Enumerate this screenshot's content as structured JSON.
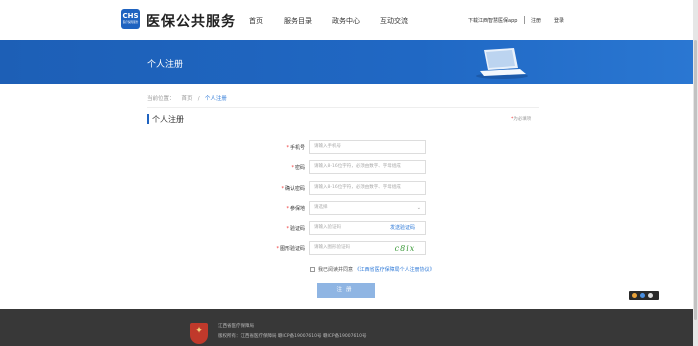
{
  "header": {
    "logo_text": "CHS",
    "logo_subtext": "医疗保障服务",
    "brand": "医保公共服务",
    "nav": [
      "首页",
      "服务目录",
      "政务中心",
      "互动交流"
    ],
    "download_app": "下载江西智慧医保app",
    "register": "注册",
    "login": "登录"
  },
  "banner": {
    "title": "个人注册"
  },
  "breadcrumb": {
    "prefix": "当前位置：",
    "home": "首页",
    "separator": "/",
    "current": "个人注册"
  },
  "section": {
    "title": "个人注册",
    "required_star": "*",
    "required_note": "为必填项"
  },
  "form": {
    "phone": {
      "label": "手机号",
      "placeholder": "请输入手机号"
    },
    "password": {
      "label": "密码",
      "placeholder": "请输入8-16位字符，必须由数字、字母组成"
    },
    "confirm_password": {
      "label": "确认密码",
      "placeholder": "请输入8-16位字符，必须由数字、字母组成"
    },
    "insured_place": {
      "label": "参保地",
      "value": "请选择"
    },
    "sms_code": {
      "label": "验证码",
      "placeholder": "请输入验证码",
      "send_label": "发送验证码"
    },
    "image_code": {
      "label": "图形验证码",
      "placeholder": "请输入图形验证码",
      "captcha_text": "c8ix"
    },
    "agreement": {
      "text": "我已阅读并同意",
      "link": "《江西省医疗保障局个人注册协议》"
    },
    "submit_label": "注册"
  },
  "footer": {
    "org": "江西省医疗保障局",
    "info": "版权所有：江西省医疗保障局 赣ICP备19007610号 赣ICP备19007610号"
  },
  "colors": {
    "primary": "#1f63c0",
    "link": "#2f7ad8",
    "required": "#e33333",
    "submit_bg": "#8fb5e3",
    "footer_bg": "#383838"
  }
}
